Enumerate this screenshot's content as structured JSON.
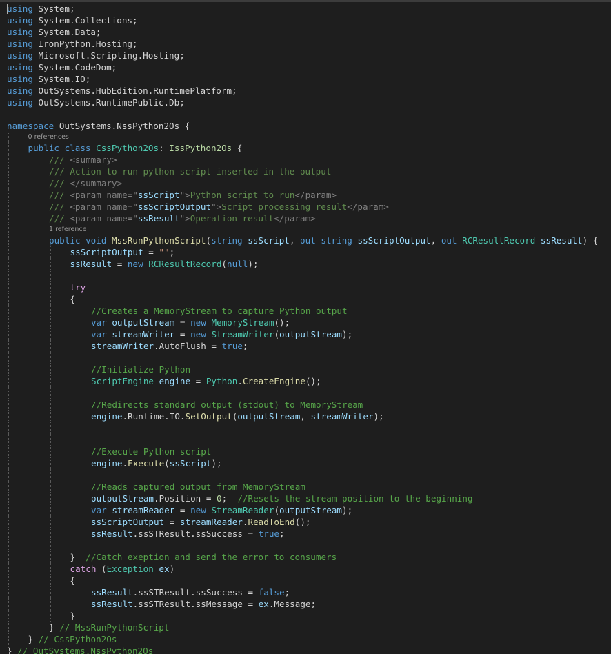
{
  "colors": {
    "background": "#1e1e1e",
    "kw": "#569cd6",
    "ctl": "#d8a0df",
    "type": "#4ec9b0",
    "iface": "#b8d7a3",
    "str": "#d69d85",
    "cm": "#57a64a",
    "doc": "#608b4e",
    "tag": "#808080",
    "attr": "#9cdcfe",
    "plain": "#d4d4d4",
    "method": "#dcdcaa",
    "hint": "#999999"
  },
  "editor": {
    "lines": [
      {
        "indent": 0,
        "tokens": [
          {
            "t": "using",
            "c": "kw"
          },
          {
            "t": " System;",
            "c": "plain"
          }
        ]
      },
      {
        "indent": 0,
        "tokens": [
          {
            "t": "using",
            "c": "kw"
          },
          {
            "t": " System.Collections;",
            "c": "plain"
          }
        ]
      },
      {
        "indent": 0,
        "tokens": [
          {
            "t": "using",
            "c": "kw"
          },
          {
            "t": " System.Data;",
            "c": "plain"
          }
        ]
      },
      {
        "indent": 0,
        "tokens": [
          {
            "t": "using",
            "c": "kw"
          },
          {
            "t": " IronPython.Hosting;",
            "c": "plain"
          }
        ]
      },
      {
        "indent": 0,
        "tokens": [
          {
            "t": "using",
            "c": "kw"
          },
          {
            "t": " Microsoft.Scripting.Hosting;",
            "c": "plain"
          }
        ]
      },
      {
        "indent": 0,
        "tokens": [
          {
            "t": "using",
            "c": "kw"
          },
          {
            "t": " System.CodeDom;",
            "c": "plain"
          }
        ]
      },
      {
        "indent": 0,
        "tokens": [
          {
            "t": "using",
            "c": "kw"
          },
          {
            "t": " System.IO;",
            "c": "plain"
          }
        ]
      },
      {
        "indent": 0,
        "tokens": [
          {
            "t": "using",
            "c": "kw"
          },
          {
            "t": " OutSystems.HubEdition.RuntimePlatform;",
            "c": "plain"
          }
        ]
      },
      {
        "indent": 0,
        "tokens": [
          {
            "t": "using",
            "c": "kw"
          },
          {
            "t": " OutSystems.RuntimePublic.Db;",
            "c": "plain"
          }
        ]
      },
      {
        "indent": 0,
        "tokens": []
      },
      {
        "indent": 0,
        "tokens": [
          {
            "t": "namespace",
            "c": "kw"
          },
          {
            "t": " OutSystems.NssPython2Os {",
            "c": "plain"
          }
        ]
      },
      {
        "indent": 1,
        "hint": true,
        "tokens": [
          {
            "t": "0 references",
            "c": "hint"
          }
        ]
      },
      {
        "indent": 1,
        "tokens": [
          {
            "t": "public",
            "c": "kw"
          },
          {
            "t": " ",
            "c": "plain"
          },
          {
            "t": "class",
            "c": "kw"
          },
          {
            "t": " ",
            "c": "plain"
          },
          {
            "t": "CssPython2Os",
            "c": "type"
          },
          {
            "t": ": ",
            "c": "plain"
          },
          {
            "t": "IssPython2Os",
            "c": "iface"
          },
          {
            "t": " {",
            "c": "plain"
          }
        ]
      },
      {
        "indent": 2,
        "tokens": [
          {
            "t": "/// ",
            "c": "doc"
          },
          {
            "t": "<summary>",
            "c": "tag"
          }
        ]
      },
      {
        "indent": 2,
        "tokens": [
          {
            "t": "/// Action to run python script inserted in the output",
            "c": "doc"
          }
        ]
      },
      {
        "indent": 2,
        "tokens": [
          {
            "t": "/// ",
            "c": "doc"
          },
          {
            "t": "</summary>",
            "c": "tag"
          }
        ]
      },
      {
        "indent": 2,
        "tokens": [
          {
            "t": "/// ",
            "c": "doc"
          },
          {
            "t": "<param name=\"",
            "c": "tag"
          },
          {
            "t": "ssScript",
            "c": "attr"
          },
          {
            "t": "\">",
            "c": "tag"
          },
          {
            "t": "Python script to run",
            "c": "doc"
          },
          {
            "t": "</param>",
            "c": "tag"
          }
        ]
      },
      {
        "indent": 2,
        "tokens": [
          {
            "t": "/// ",
            "c": "doc"
          },
          {
            "t": "<param name=\"",
            "c": "tag"
          },
          {
            "t": "ssScriptOutput",
            "c": "attr"
          },
          {
            "t": "\">",
            "c": "tag"
          },
          {
            "t": "Script processing result",
            "c": "doc"
          },
          {
            "t": "</param>",
            "c": "tag"
          }
        ]
      },
      {
        "indent": 2,
        "tokens": [
          {
            "t": "/// ",
            "c": "doc"
          },
          {
            "t": "<param name=\"",
            "c": "tag"
          },
          {
            "t": "ssResult",
            "c": "attr"
          },
          {
            "t": "\">",
            "c": "tag"
          },
          {
            "t": "Operation result",
            "c": "doc"
          },
          {
            "t": "</param>",
            "c": "tag"
          }
        ]
      },
      {
        "indent": 2,
        "hint": true,
        "tokens": [
          {
            "t": "1 reference",
            "c": "hint"
          }
        ]
      },
      {
        "indent": 2,
        "tokens": [
          {
            "t": "public",
            "c": "kw"
          },
          {
            "t": " ",
            "c": "plain"
          },
          {
            "t": "void",
            "c": "kw"
          },
          {
            "t": " ",
            "c": "plain"
          },
          {
            "t": "MssRunPythonScript",
            "c": "method"
          },
          {
            "t": "(",
            "c": "plain"
          },
          {
            "t": "string",
            "c": "kw"
          },
          {
            "t": " ",
            "c": "plain"
          },
          {
            "t": "ssScript",
            "c": "attr"
          },
          {
            "t": ", ",
            "c": "plain"
          },
          {
            "t": "out",
            "c": "kw"
          },
          {
            "t": " ",
            "c": "plain"
          },
          {
            "t": "string",
            "c": "kw"
          },
          {
            "t": " ",
            "c": "plain"
          },
          {
            "t": "ssScriptOutput",
            "c": "attr"
          },
          {
            "t": ", ",
            "c": "plain"
          },
          {
            "t": "out",
            "c": "kw"
          },
          {
            "t": " ",
            "c": "plain"
          },
          {
            "t": "RCResultRecord",
            "c": "type"
          },
          {
            "t": " ",
            "c": "plain"
          },
          {
            "t": "ssResult",
            "c": "attr"
          },
          {
            "t": ") {",
            "c": "plain"
          }
        ]
      },
      {
        "indent": 3,
        "tokens": [
          {
            "t": "ssScriptOutput",
            "c": "attr"
          },
          {
            "t": " = ",
            "c": "plain"
          },
          {
            "t": "\"\"",
            "c": "str"
          },
          {
            "t": ";",
            "c": "plain"
          }
        ]
      },
      {
        "indent": 3,
        "tokens": [
          {
            "t": "ssResult",
            "c": "attr"
          },
          {
            "t": " = ",
            "c": "plain"
          },
          {
            "t": "new",
            "c": "kw"
          },
          {
            "t": " ",
            "c": "plain"
          },
          {
            "t": "RCResultRecord",
            "c": "type"
          },
          {
            "t": "(",
            "c": "plain"
          },
          {
            "t": "null",
            "c": "kw"
          },
          {
            "t": ");",
            "c": "plain"
          }
        ]
      },
      {
        "indent": 3,
        "tokens": []
      },
      {
        "indent": 3,
        "tokens": [
          {
            "t": "try",
            "c": "ctl"
          }
        ]
      },
      {
        "indent": 3,
        "tokens": [
          {
            "t": "{",
            "c": "plain"
          }
        ]
      },
      {
        "indent": 4,
        "tokens": [
          {
            "t": "//Creates a MemoryStream to capture Python output",
            "c": "cm"
          }
        ]
      },
      {
        "indent": 4,
        "tokens": [
          {
            "t": "var",
            "c": "kw"
          },
          {
            "t": " ",
            "c": "plain"
          },
          {
            "t": "outputStream",
            "c": "attr"
          },
          {
            "t": " = ",
            "c": "plain"
          },
          {
            "t": "new",
            "c": "kw"
          },
          {
            "t": " ",
            "c": "plain"
          },
          {
            "t": "MemoryStream",
            "c": "type"
          },
          {
            "t": "();",
            "c": "plain"
          }
        ]
      },
      {
        "indent": 4,
        "tokens": [
          {
            "t": "var",
            "c": "kw"
          },
          {
            "t": " ",
            "c": "plain"
          },
          {
            "t": "streamWriter",
            "c": "attr"
          },
          {
            "t": " = ",
            "c": "plain"
          },
          {
            "t": "new",
            "c": "kw"
          },
          {
            "t": " ",
            "c": "plain"
          },
          {
            "t": "StreamWriter",
            "c": "type"
          },
          {
            "t": "(",
            "c": "plain"
          },
          {
            "t": "outputStream",
            "c": "attr"
          },
          {
            "t": ");",
            "c": "plain"
          }
        ]
      },
      {
        "indent": 4,
        "tokens": [
          {
            "t": "streamWriter",
            "c": "attr"
          },
          {
            "t": ".AutoFlush = ",
            "c": "plain"
          },
          {
            "t": "true",
            "c": "kw"
          },
          {
            "t": ";",
            "c": "plain"
          }
        ]
      },
      {
        "indent": 4,
        "tokens": []
      },
      {
        "indent": 4,
        "tokens": [
          {
            "t": "//Initialize Python",
            "c": "cm"
          }
        ]
      },
      {
        "indent": 4,
        "tokens": [
          {
            "t": "ScriptEngine",
            "c": "type"
          },
          {
            "t": " ",
            "c": "plain"
          },
          {
            "t": "engine",
            "c": "attr"
          },
          {
            "t": " = ",
            "c": "plain"
          },
          {
            "t": "Python",
            "c": "type"
          },
          {
            "t": ".",
            "c": "plain"
          },
          {
            "t": "CreateEngine",
            "c": "method"
          },
          {
            "t": "();",
            "c": "plain"
          }
        ]
      },
      {
        "indent": 4,
        "tokens": []
      },
      {
        "indent": 4,
        "tokens": [
          {
            "t": "//Redirects standard output (stdout) to MemoryStream",
            "c": "cm"
          }
        ]
      },
      {
        "indent": 4,
        "tokens": [
          {
            "t": "engine",
            "c": "attr"
          },
          {
            "t": ".Runtime.IO.",
            "c": "plain"
          },
          {
            "t": "SetOutput",
            "c": "method"
          },
          {
            "t": "(",
            "c": "plain"
          },
          {
            "t": "outputStream",
            "c": "attr"
          },
          {
            "t": ", ",
            "c": "plain"
          },
          {
            "t": "streamWriter",
            "c": "attr"
          },
          {
            "t": ");",
            "c": "plain"
          }
        ]
      },
      {
        "indent": 4,
        "tokens": []
      },
      {
        "indent": 4,
        "tokens": []
      },
      {
        "indent": 4,
        "tokens": [
          {
            "t": "//Execute Python script",
            "c": "cm"
          }
        ]
      },
      {
        "indent": 4,
        "tokens": [
          {
            "t": "engine",
            "c": "attr"
          },
          {
            "t": ".",
            "c": "plain"
          },
          {
            "t": "Execute",
            "c": "method"
          },
          {
            "t": "(",
            "c": "plain"
          },
          {
            "t": "ssScript",
            "c": "attr"
          },
          {
            "t": ");",
            "c": "plain"
          }
        ]
      },
      {
        "indent": 4,
        "tokens": []
      },
      {
        "indent": 4,
        "tokens": [
          {
            "t": "//Reads captured output from MemoryStream",
            "c": "cm"
          }
        ]
      },
      {
        "indent": 4,
        "tokens": [
          {
            "t": "outputStream",
            "c": "attr"
          },
          {
            "t": ".Position = ",
            "c": "plain"
          },
          {
            "t": "0",
            "c": "iface"
          },
          {
            "t": ";  ",
            "c": "plain"
          },
          {
            "t": "//Resets the stream position to the beginning",
            "c": "cm"
          }
        ]
      },
      {
        "indent": 4,
        "tokens": [
          {
            "t": "var",
            "c": "kw"
          },
          {
            "t": " ",
            "c": "plain"
          },
          {
            "t": "streamReader",
            "c": "attr"
          },
          {
            "t": " = ",
            "c": "plain"
          },
          {
            "t": "new",
            "c": "kw"
          },
          {
            "t": " ",
            "c": "plain"
          },
          {
            "t": "StreamReader",
            "c": "type"
          },
          {
            "t": "(",
            "c": "plain"
          },
          {
            "t": "outputStream",
            "c": "attr"
          },
          {
            "t": ");",
            "c": "plain"
          }
        ]
      },
      {
        "indent": 4,
        "tokens": [
          {
            "t": "ssScriptOutput",
            "c": "attr"
          },
          {
            "t": " = ",
            "c": "plain"
          },
          {
            "t": "streamReader",
            "c": "attr"
          },
          {
            "t": ".",
            "c": "plain"
          },
          {
            "t": "ReadToEnd",
            "c": "method"
          },
          {
            "t": "();",
            "c": "plain"
          }
        ]
      },
      {
        "indent": 4,
        "tokens": [
          {
            "t": "ssResult",
            "c": "attr"
          },
          {
            "t": ".ssSTResult.ssSuccess = ",
            "c": "plain"
          },
          {
            "t": "true",
            "c": "kw"
          },
          {
            "t": ";",
            "c": "plain"
          }
        ]
      },
      {
        "indent": 4,
        "tokens": []
      },
      {
        "indent": 3,
        "tokens": [
          {
            "t": "}  ",
            "c": "plain"
          },
          {
            "t": "//Catch exeption and send the error to consumers",
            "c": "cm"
          }
        ]
      },
      {
        "indent": 3,
        "tokens": [
          {
            "t": "catch",
            "c": "ctl"
          },
          {
            "t": " (",
            "c": "plain"
          },
          {
            "t": "Exception",
            "c": "type"
          },
          {
            "t": " ",
            "c": "plain"
          },
          {
            "t": "ex",
            "c": "attr"
          },
          {
            "t": ")",
            "c": "plain"
          }
        ]
      },
      {
        "indent": 3,
        "tokens": [
          {
            "t": "{",
            "c": "plain"
          }
        ]
      },
      {
        "indent": 4,
        "tokens": [
          {
            "t": "ssResult",
            "c": "attr"
          },
          {
            "t": ".ssSTResult.ssSuccess = ",
            "c": "plain"
          },
          {
            "t": "false",
            "c": "kw"
          },
          {
            "t": ";",
            "c": "plain"
          }
        ]
      },
      {
        "indent": 4,
        "tokens": [
          {
            "t": "ssResult",
            "c": "attr"
          },
          {
            "t": ".ssSTResult.ssMessage = ",
            "c": "plain"
          },
          {
            "t": "ex",
            "c": "attr"
          },
          {
            "t": ".Message;",
            "c": "plain"
          }
        ]
      },
      {
        "indent": 3,
        "tokens": [
          {
            "t": "}",
            "c": "plain"
          }
        ]
      },
      {
        "indent": 2,
        "tokens": [
          {
            "t": "} ",
            "c": "plain"
          },
          {
            "t": "// MssRunPythonScript",
            "c": "cm"
          }
        ]
      },
      {
        "indent": 1,
        "tokens": [
          {
            "t": "} ",
            "c": "plain"
          },
          {
            "t": "// CssPython2Os",
            "c": "cm"
          }
        ]
      },
      {
        "indent": 0,
        "tokens": [
          {
            "t": "} ",
            "c": "plain"
          },
          {
            "t": "// OutSystems.NssPython2Os",
            "c": "cm"
          }
        ]
      }
    ]
  }
}
